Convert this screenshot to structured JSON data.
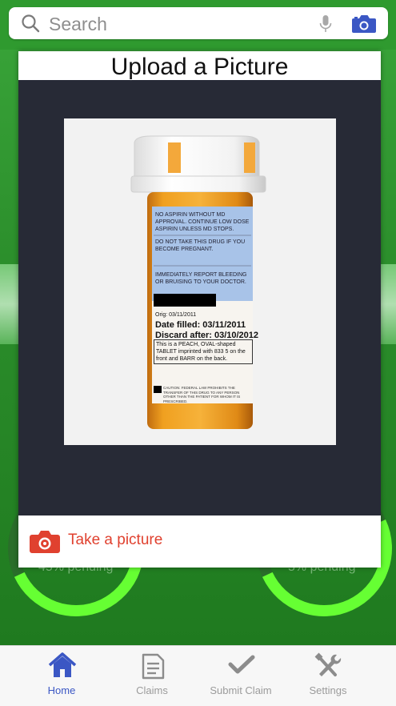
{
  "search": {
    "placeholder": "Search",
    "icons": [
      "search-icon",
      "mic-icon",
      "camera-icon"
    ]
  },
  "background": {
    "left_pending": "45% pending",
    "right_pending": "5% pending"
  },
  "modal": {
    "title": "Upload a Picture",
    "take_picture_label": "Take a picture",
    "photo": {
      "label_lines": [
        "NO ASPIRIN WITHOUT MD",
        "APPROVAL. CONTINUE LOW DOSE",
        "ASPIRIN UNLESS MD STOPS.",
        "DO NOT TAKE THIS DRUG IF YOU",
        "BECOME PREGNANT.",
        "IMMEDIATELY REPORT BLEEDING",
        "OR BRUISING TO YOUR DOCTOR."
      ],
      "orig": "Orig: 03/11/2011",
      "date_filled": "Date filled: 03/11/2011",
      "discard_after": "Discard after: 03/10/2012",
      "description": "This is a PEACH, OVAL-shaped TABLET imprinted with 833 5 on the front and BARR on the back.",
      "caution": "CAUTION: FEDERAL LAW PROHIBITS THE TRANSFER OF THIS DRUG TO ANY PERSON OTHER THAN THE PATIENT FOR WHOM IT IS PRESCRIBED."
    }
  },
  "tabs": [
    {
      "label": "Home",
      "icon": "home-icon",
      "active": true
    },
    {
      "label": "Claims",
      "icon": "document-icon",
      "active": false
    },
    {
      "label": "Submit Claim",
      "icon": "checkmark-icon",
      "active": false
    },
    {
      "label": "Settings",
      "icon": "tools-icon",
      "active": false
    }
  ],
  "colors": {
    "accent_blue": "#3b57c4",
    "take_picture_red": "#e0412f",
    "bottle_orange": "#e0911c",
    "modal_dark": "#272a36"
  }
}
